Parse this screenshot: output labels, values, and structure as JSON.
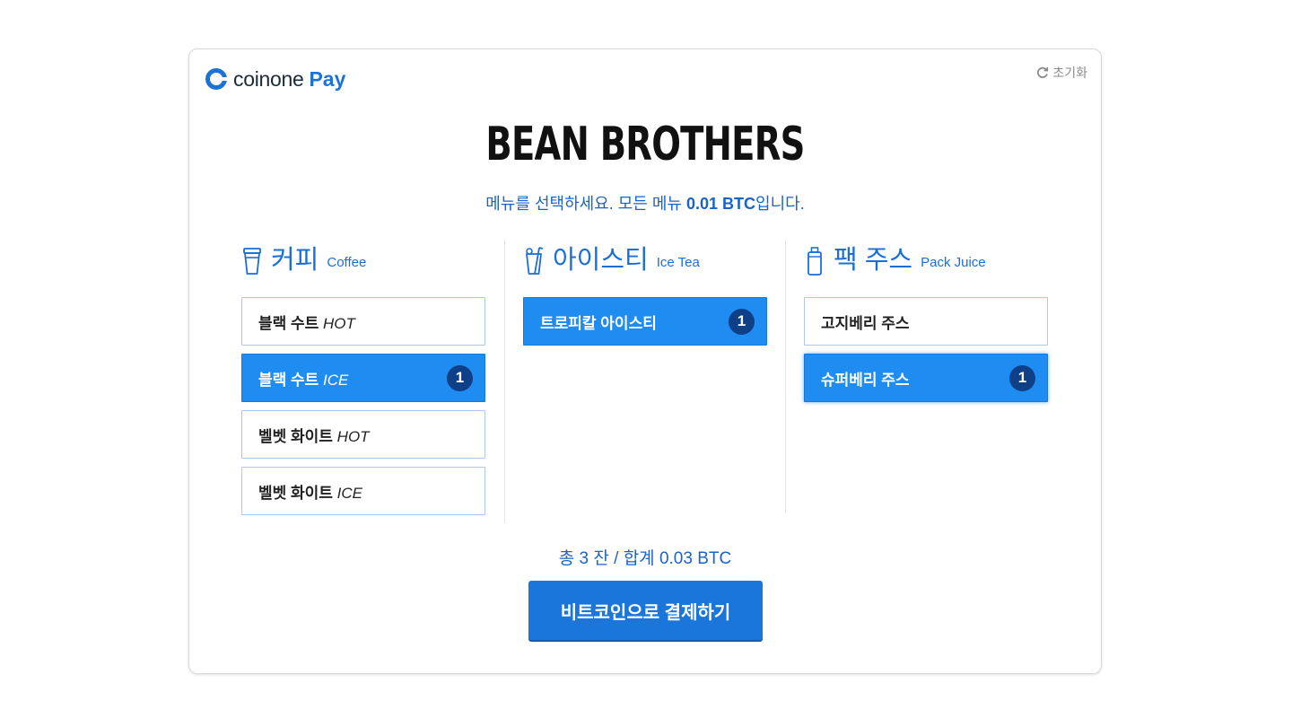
{
  "brand": {
    "word": "coinone",
    "pay": "Pay",
    "accent": "#1a74d8"
  },
  "reset_label": "초기화",
  "store_name": "BEAN BROTHERS",
  "subtitle": {
    "prefix": "메뉴를 선택하세요. 모든 메뉴 ",
    "price": "0.01 BTC",
    "suffix": "입니다."
  },
  "categories": [
    {
      "icon": "cup-icon",
      "title_kr": "커피",
      "title_en": "Coffee",
      "items": [
        {
          "name": "블랙 수트",
          "variant": "HOT",
          "count": null,
          "selected": false
        },
        {
          "name": "블랙 수트",
          "variant": "ICE",
          "count": "1",
          "selected": true
        },
        {
          "name": "벨벳 화이트",
          "variant": "HOT",
          "count": null,
          "selected": false
        },
        {
          "name": "벨벳 화이트",
          "variant": "ICE",
          "count": null,
          "selected": false
        }
      ]
    },
    {
      "icon": "iced-drink-icon",
      "title_kr": "아이스티",
      "title_en": "Ice Tea",
      "items": [
        {
          "name": "트로피칼 아이스티",
          "variant": "",
          "count": "1",
          "selected": true
        }
      ]
    },
    {
      "icon": "juice-pack-icon",
      "title_kr": "팩 주스",
      "title_en": "Pack Juice",
      "items": [
        {
          "name": "고지베리 주스",
          "variant": "",
          "count": null,
          "selected": false
        },
        {
          "name": "슈퍼베리 주스",
          "variant": "",
          "count": "1",
          "selected": true
        }
      ]
    }
  ],
  "summary": "총 3 잔 /  합계 0.03 BTC",
  "pay_button": "비트코인으로 결제하기",
  "colors": {
    "primary": "#1f8cf2",
    "badge": "#0f3f86",
    "text_blue": "#1a63c9"
  }
}
